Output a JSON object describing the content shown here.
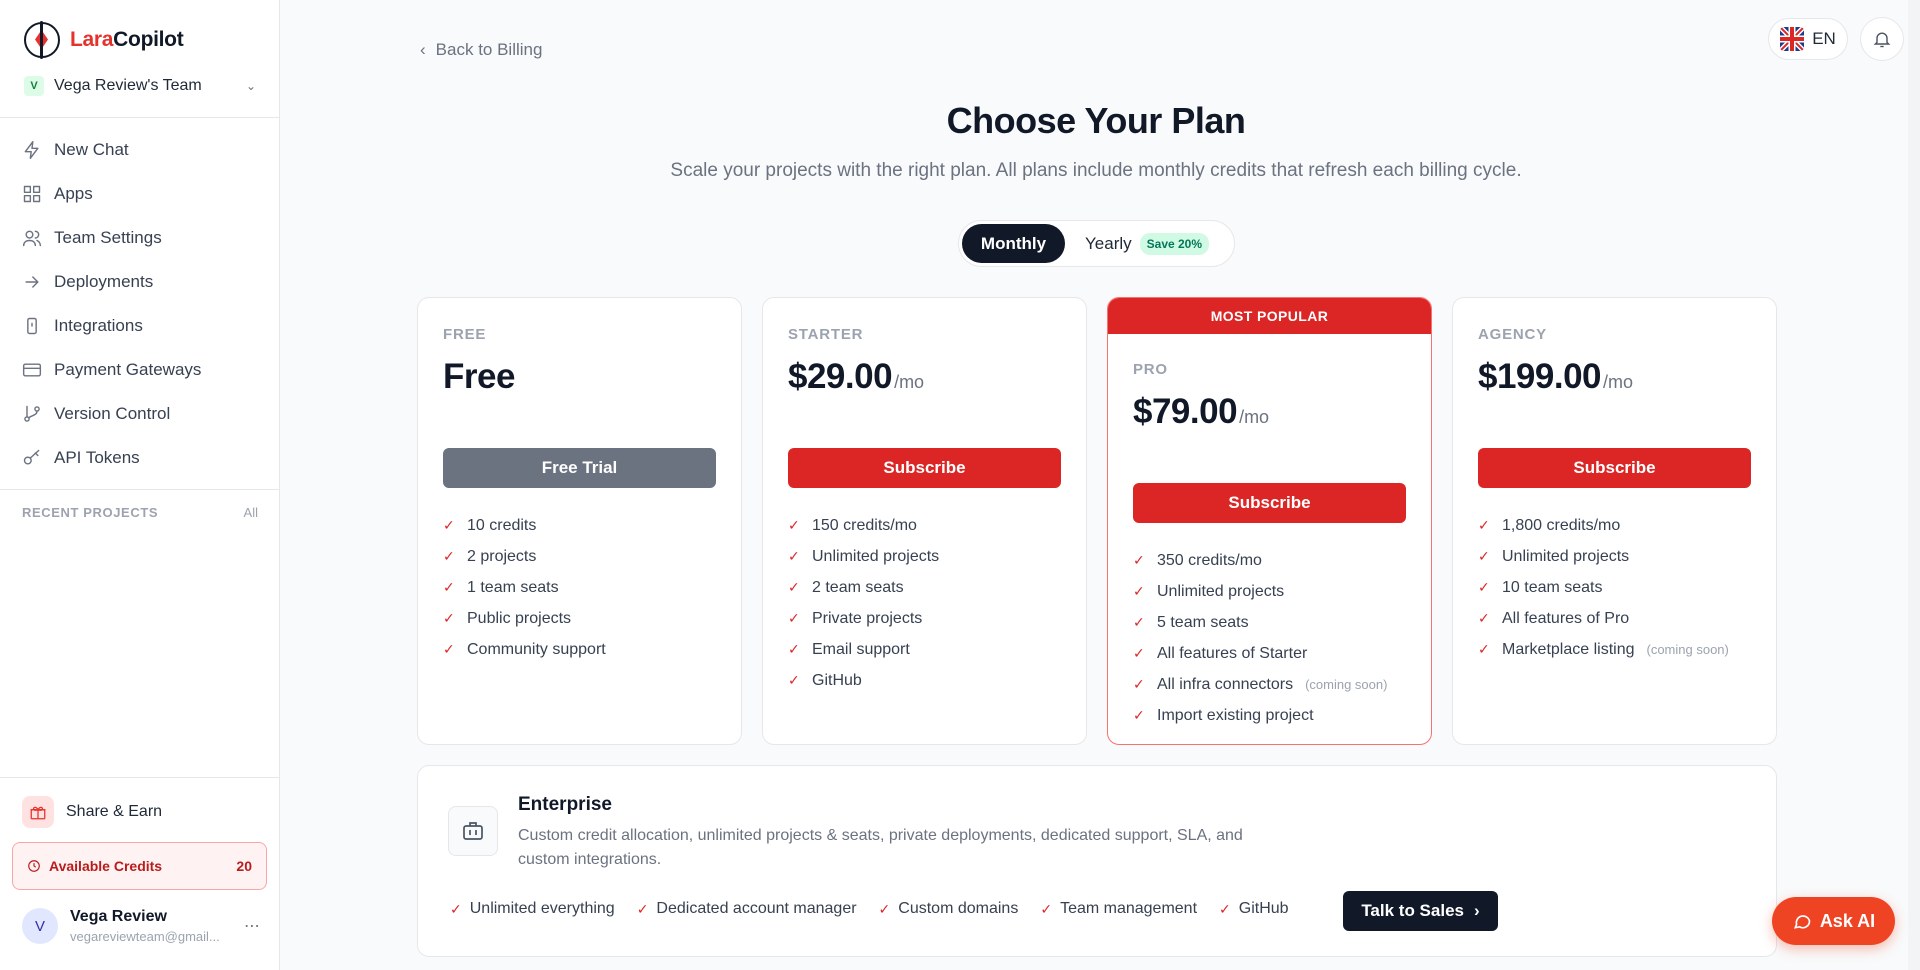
{
  "brand": {
    "part1": "Lara",
    "part2": "Copilot"
  },
  "team": {
    "initial": "V",
    "name": "Vega Review's Team"
  },
  "nav": [
    {
      "label": "New Chat",
      "icon": "bolt-icon"
    },
    {
      "label": "Apps",
      "icon": "grid-icon"
    },
    {
      "label": "Team Settings",
      "icon": "users-icon"
    },
    {
      "label": "Deployments",
      "icon": "arrow-right-icon"
    },
    {
      "label": "Integrations",
      "icon": "plug-icon"
    },
    {
      "label": "Payment Gateways",
      "icon": "credit-card-icon"
    },
    {
      "label": "Version Control",
      "icon": "git-branch-icon"
    },
    {
      "label": "API Tokens",
      "icon": "key-icon"
    }
  ],
  "recent": {
    "title": "RECENT PROJECTS",
    "all": "All"
  },
  "share": {
    "label": "Share & Earn"
  },
  "credits": {
    "label": "Available Credits",
    "value": "20"
  },
  "user": {
    "initial": "V",
    "name": "Vega Review",
    "email": "vegareviewteam@gmail..."
  },
  "lang": {
    "code": "EN"
  },
  "back": {
    "label": "Back to Billing"
  },
  "header": {
    "title": "Choose Your Plan",
    "subtitle": "Scale your projects with the right plan. All plans include monthly credits that refresh each billing cycle."
  },
  "toggle": {
    "monthly": "Monthly",
    "yearly": "Yearly",
    "save": "Save 20%"
  },
  "plans": [
    {
      "tier": "FREE",
      "price": "Free",
      "per": "",
      "button": "Free Trial",
      "features": [
        "10 credits",
        "2 projects",
        "1 team seats",
        "Public projects",
        "Community support"
      ]
    },
    {
      "tier": "STARTER",
      "price": "$29.00",
      "per": "/mo",
      "button": "Subscribe",
      "features": [
        "150 credits/mo",
        "Unlimited projects",
        "2 team seats",
        "Private projects",
        "Email support",
        "GitHub"
      ]
    },
    {
      "tier": "PRO",
      "badge": "MOST POPULAR",
      "price": "$79.00",
      "per": "/mo",
      "button": "Subscribe",
      "features": [
        "350 credits/mo",
        "Unlimited projects",
        "5 team seats",
        "All features of Starter",
        "All infra connectors",
        "Import existing project"
      ],
      "soon_note": "(coming soon)"
    },
    {
      "tier": "AGENCY",
      "price": "$199.00",
      "per": "/mo",
      "button": "Subscribe",
      "features": [
        "1,800 credits/mo",
        "Unlimited projects",
        "10 team seats",
        "All features of Pro",
        "Marketplace listing"
      ],
      "soon_note": "(coming soon)"
    }
  ],
  "enterprise": {
    "title": "Enterprise",
    "description": "Custom credit allocation, unlimited projects & seats, private deployments, dedicated support, SLA, and custom integrations.",
    "features": [
      "Unlimited everything",
      "Dedicated account manager",
      "Custom domains",
      "Team management",
      "GitHub"
    ],
    "cta": "Talk to Sales"
  },
  "ask_ai": {
    "label": "Ask AI"
  },
  "colors": {
    "accent": "#dc2626",
    "dark": "#111827",
    "save_badge": "#047857"
  }
}
